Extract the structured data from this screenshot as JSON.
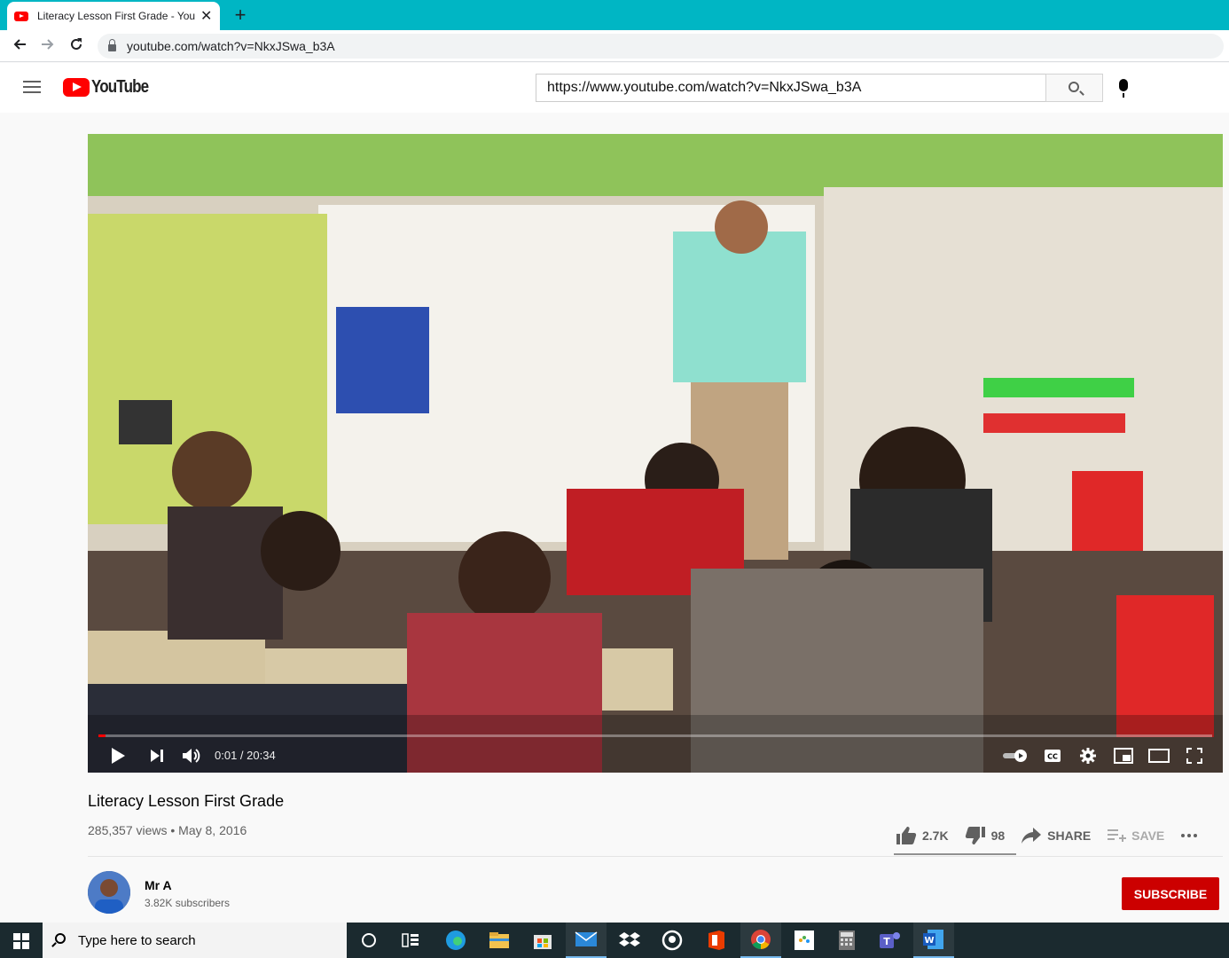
{
  "browser": {
    "tab_title": "Literacy Lesson First Grade - YouTube",
    "tab_close": "✕",
    "new_tab": "+",
    "url": "youtube.com/watch?v=NkxJSwa_b3A"
  },
  "youtube": {
    "logo_text": "YouTube",
    "search_value": "https://www.youtube.com/watch?v=NkxJSwa_b3A"
  },
  "player": {
    "time": "0:01 / 20:34",
    "progress": 0.001,
    "colors": {
      "progress_played": "#ff0000"
    }
  },
  "video": {
    "title": "Literacy Lesson First Grade",
    "meta": "285,357 views • May 8, 2016",
    "likes": "2.7K",
    "dislikes": "98",
    "share_label": "SHARE",
    "save_label": "SAVE"
  },
  "channel": {
    "name": "Mr A",
    "subscribers": "3.82K subscribers",
    "subscribe_label": "SUBSCRIBE"
  },
  "taskbar": {
    "search_placeholder": "Type here to search",
    "icons": [
      "cortana-icon",
      "task-view-icon",
      "edge-icon",
      "file-explorer-icon",
      "store-icon",
      "mail-icon",
      "dropbox-icon",
      "github-icon",
      "office-icon",
      "chrome-icon",
      "photos-icon",
      "calculator-icon",
      "teams-icon",
      "word-icon"
    ]
  },
  "colors": {
    "accent": "#cc0000",
    "tabstrip": "#00b6c4",
    "taskbar": "#1b2a2f"
  }
}
